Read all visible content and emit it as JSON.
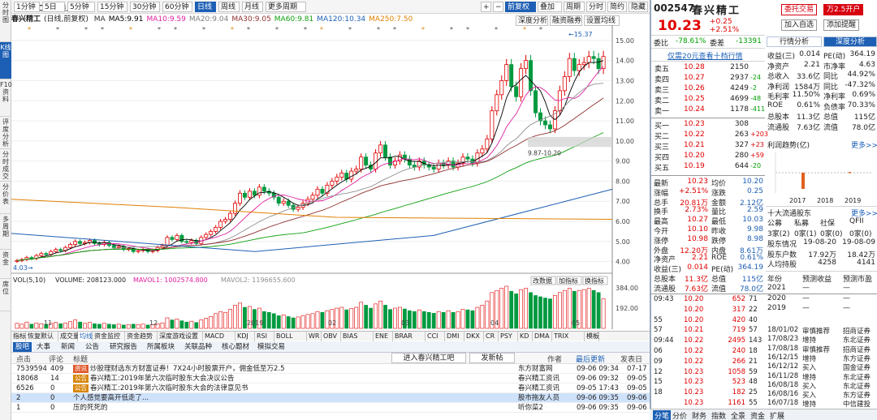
{
  "vertical_tabs": [
    "分时图",
    "K线图",
    "F10资料",
    "评度分析",
    "分时成交",
    "分价表",
    "多周期",
    "资金",
    "席位"
  ],
  "toolbar": {
    "stock_name": "春兴精工",
    "mode": "(日线,前复权)",
    "periods": [
      "1分钟",
      "5日",
      "5分钟",
      "15分钟",
      "30分钟",
      "60分钟",
      "日线",
      "周线",
      "月线",
      "更多周期"
    ],
    "selected_period": "日线",
    "right_buttons": [
      "+",
      "−",
      "前复权",
      "叠加",
      "周期",
      "分时",
      "简约",
      "隐藏",
      "均线"
    ],
    "sub_buttons": [
      "深度分析",
      "融资融券",
      "设置均线"
    ]
  },
  "ma_legend": [
    {
      "label": "MA",
      "value": "",
      "color": "#333333"
    },
    {
      "label": "MA5:",
      "value": "9.91",
      "color": "#000000"
    },
    {
      "label": "MA10:",
      "value": "9.59",
      "color": "#e020a0"
    },
    {
      "label": "MA20:",
      "value": "9.04",
      "color": "#808080"
    },
    {
      "label": "MA30:",
      "value": "9.05",
      "color": "#903030"
    },
    {
      "label": "MA60:",
      "value": "9.81",
      "color": "#10a010"
    },
    {
      "label": "MA120:",
      "value": "10.34",
      "color": "#1d5fb4"
    },
    {
      "label": "MA250:",
      "value": "7.50",
      "color": "#e08000"
    }
  ],
  "chart_data": {
    "type": "candlestick",
    "y_ticks": [
      "15.00",
      "14.00",
      "13.00",
      "12.00",
      "11.00",
      "10.00",
      "9.00",
      "8.00",
      "7.00",
      "6.00",
      "5.00",
      "4.00"
    ],
    "x_labels": [
      "11",
      "12",
      "2019",
      "02",
      "03",
      "04",
      "05"
    ],
    "high_label": "15.37",
    "low_label": "4.03",
    "mark_label": "9.87-10.20",
    "volume_ticks": [
      "384.00",
      "192.00"
    ],
    "volume_legend": {
      "vol": "VOL(5,10)",
      "volume": "VOLUME: 208123.000",
      "mavol1": "MAVOL1: 1002574.800",
      "mavol2": "MAVOL2: 1196655.600"
    },
    "volume_buttons": [
      "改数据",
      "加指标",
      "换指标"
    ],
    "price_ylim": [
      3.5,
      15.6
    ],
    "candles_close": [
      4.05,
      4.1,
      4.2,
      4.15,
      4.3,
      4.4,
      4.35,
      4.5,
      4.6,
      4.55,
      4.7,
      4.85,
      5.0,
      4.9,
      4.95,
      5.05,
      4.9,
      4.85,
      4.95,
      4.8,
      4.7,
      4.75,
      4.6,
      4.65,
      4.5,
      4.55,
      4.6,
      4.5,
      4.55,
      4.7,
      4.8,
      5.2,
      5.1,
      5.3,
      5.0,
      4.95,
      5.05,
      4.9,
      5.2,
      5.35,
      5.5,
      5.7,
      6.0,
      6.1,
      6.4,
      6.9,
      7.4,
      7.2,
      7.5,
      7.3,
      7.7,
      7.5,
      7.4,
      7.2,
      6.9,
      7.0,
      6.8,
      6.6,
      6.7,
      6.9,
      7.1,
      7.3,
      7.6,
      7.4,
      7.8,
      8.0,
      8.2,
      8.4,
      8.1,
      8.5,
      8.6,
      9.2,
      8.8,
      8.6,
      9.4,
      9.8,
      9.2,
      8.8,
      9.0,
      9.3,
      9.1,
      8.8,
      8.7,
      9.0,
      8.8,
      8.7,
      8.6,
      8.9,
      8.8,
      9.0,
      8.7,
      8.9,
      9.2,
      9.1,
      8.9,
      9.4,
      9.6,
      10.1,
      11.5,
      12.3,
      13.0,
      13.8,
      12.7,
      12.2,
      13.6,
      14.0,
      12.5,
      11.4,
      11.0,
      10.8,
      10.6,
      11.5,
      12.5,
      13.2,
      14.1,
      13.5,
      13.8,
      13.9,
      14.2,
      14.1,
      13.6,
      14.2
    ],
    "volume": [
      0.12,
      0.1,
      0.15,
      0.1,
      0.13,
      0.11,
      0.1,
      0.12,
      0.14,
      0.11,
      0.13,
      0.16,
      0.2,
      0.15,
      0.12,
      0.14,
      0.11,
      0.1,
      0.12,
      0.1,
      0.09,
      0.1,
      0.08,
      0.09,
      0.1,
      0.09,
      0.1,
      0.08,
      0.09,
      0.11,
      0.13,
      0.25,
      0.2,
      0.22,
      0.18,
      0.15,
      0.17,
      0.14,
      0.2,
      0.24,
      0.28,
      0.35,
      0.4,
      0.38,
      0.45,
      0.55,
      0.6,
      0.5,
      0.52,
      0.45,
      0.48,
      0.4,
      0.38,
      0.35,
      0.3,
      0.32,
      0.28,
      0.25,
      0.27,
      0.3,
      0.33,
      0.35,
      0.4,
      0.38,
      0.42,
      0.45,
      0.48,
      0.5,
      0.44,
      0.47,
      0.5,
      0.62,
      0.55,
      0.48,
      0.58,
      0.65,
      0.55,
      0.45,
      0.48,
      0.5,
      0.46,
      0.42,
      0.4,
      0.44,
      0.4,
      0.38,
      0.36,
      0.4,
      0.38,
      0.42,
      0.38,
      0.4,
      0.45,
      0.44,
      0.42,
      0.5,
      0.55,
      0.65,
      0.85,
      0.9,
      0.95,
      1.0,
      0.88,
      0.82,
      0.92,
      0.95,
      0.85,
      0.78,
      0.75,
      0.72,
      0.7,
      0.78,
      0.85,
      0.9,
      0.95,
      0.88,
      0.9,
      0.92,
      0.95,
      0.9,
      0.85,
      0.7
    ]
  },
  "indicator_tabs": [
    "指标",
    "恢复默认",
    "成交量",
    "均线",
    "资金监控",
    "资金趋势",
    "深度游戏设置",
    "MACD",
    "KDJ",
    "RSI",
    "BOLL",
    "WR",
    "OBV",
    "BIAS",
    "ENE",
    "BRAR",
    "CCI",
    "DMI",
    "DKX",
    "CR",
    "PSY",
    "KD",
    "DMA",
    "TRIX",
    "模板"
  ],
  "news": {
    "tabs": [
      "股吧",
      "大事",
      "新闻",
      "公告",
      "研究报告",
      "所属板块",
      "关联品种",
      "核心题材",
      "模拟交易"
    ],
    "bar_buttons": [
      "进入春兴精工吧",
      "发新帖"
    ],
    "headers": {
      "clicks": "点击",
      "comments": "评论",
      "title": "标题",
      "author": "作者",
      "updated": "最后更新",
      "posted": "发表日"
    },
    "rows": [
      {
        "clicks": "7539594",
        "comments": "409",
        "tag": "资讯",
        "title": "炒股理财选东方财富证券！7X24小时股票开户，佣金低至万2.5",
        "author": "东方财富网",
        "updated": "09-06 09:34",
        "posted": "07-17"
      },
      {
        "clicks": "18068",
        "comments": "14",
        "tag": "公告",
        "title": "春兴精工:2019年第六次临时股东大会决议公告",
        "author": "春兴精工资讯",
        "updated": "09-06 09:32",
        "posted": "09-05"
      },
      {
        "clicks": "6526",
        "comments": "0",
        "tag": "公告",
        "title": "春兴精工:2019年第六次临时股东大会的法律意见书",
        "author": "春兴精工资讯",
        "updated": "09-05 17:43",
        "posted": "09-05"
      },
      {
        "clicks": "2",
        "comments": "0",
        "tag": "",
        "title": "个人感觉要高开低走了...",
        "author": "股市拖友人员",
        "updated": "09-06 09:35",
        "posted": "09-06"
      },
      {
        "clicks": "1",
        "comments": "0",
        "tag": "",
        "title": "压的死死的",
        "author": "听你菜2",
        "updated": "09-06 09:35",
        "posted": "09-06"
      }
    ]
  },
  "quote": {
    "code": "002547",
    "name": "春兴精工",
    "buttons": [
      "委托交易",
      "万2.5开户",
      "加入自选",
      "添加提醒"
    ],
    "price": "10.23",
    "change": "+0.25",
    "change_pct": "+2.51%",
    "weibi_label": "委比",
    "weibi": "-78.61%",
    "weicha_label": "委差",
    "weicha": "-13391",
    "sub_tabs": [
      "行情分析",
      "深度分析"
    ],
    "level2_link": "仅需20元查看十档行情",
    "asks": [
      {
        "label": "卖五",
        "price": "10.28",
        "vol": "2150",
        "chg": ""
      },
      {
        "label": "卖四",
        "price": "10.27",
        "vol": "2937",
        "chg": "-24"
      },
      {
        "label": "卖三",
        "price": "10.26",
        "vol": "4249",
        "chg": "-2"
      },
      {
        "label": "卖二",
        "price": "10.25",
        "vol": "4699",
        "chg": "-48"
      },
      {
        "label": "卖一",
        "price": "10.24",
        "vol": "1178",
        "chg": "-411"
      }
    ],
    "bids": [
      {
        "label": "买一",
        "price": "10.23",
        "vol": "308",
        "chg": ""
      },
      {
        "label": "买二",
        "price": "10.22",
        "vol": "263",
        "chg": "+203"
      },
      {
        "label": "买三",
        "price": "10.21",
        "vol": "327",
        "chg": "+23"
      },
      {
        "label": "买四",
        "price": "10.20",
        "vol": "280",
        "chg": "+59"
      },
      {
        "label": "买五",
        "price": "10.19",
        "vol": "644",
        "chg": "-20"
      }
    ],
    "stats": [
      [
        "最新",
        "10.23",
        "均价",
        "10.20"
      ],
      [
        "涨幅",
        "+2.51%",
        "涨跌",
        "0.25"
      ],
      [
        "总手",
        "20.81万",
        "金额",
        "2.12亿"
      ],
      [
        "换手",
        "2.73%",
        "量比",
        "2.59"
      ],
      [
        "最高",
        "10.27",
        "最低",
        "10.03"
      ],
      [
        "今开",
        "10.10",
        "昨收",
        "9.98"
      ],
      [
        "涨停",
        "10.98",
        "跌停",
        "8.98"
      ],
      [
        "外盘",
        "12.20万",
        "内盘",
        "8.61万"
      ],
      [
        "净资产",
        "2.21",
        "ROE",
        "0.61%"
      ],
      [
        "收益(三)",
        "0.014",
        "PE(动)",
        "364.19"
      ],
      [
        "总股本",
        "11.3亿",
        "总值",
        "115亿"
      ],
      [
        "流通股",
        "7.63亿",
        "流值",
        "78.0亿"
      ]
    ],
    "fin": [
      [
        "收益(三)",
        "0.014",
        "PE(动)",
        "364.19"
      ],
      [
        "净资产",
        "2.21",
        "市净率",
        "4.63"
      ],
      [
        "总收入",
        "33.6亿",
        "同比",
        "44.92%"
      ],
      [
        "净利润",
        "1584万",
        "同比",
        "-47.32%"
      ],
      [
        "毛利率",
        "11.50%",
        "净利率",
        "0.69%"
      ],
      [
        "ROE",
        "0.61%",
        "负债率",
        "70.33%"
      ],
      [
        "总股本",
        "11.3亿",
        "总值",
        "115亿"
      ],
      [
        "流通股",
        "7.63亿",
        "流值",
        "78.0亿"
      ]
    ],
    "profit_title": "利润趋势(亿)",
    "profit_more": "更多>>",
    "profit_years": [
      "2017",
      "2018",
      "2019"
    ],
    "holders_title": "十大流通股东",
    "holders_more": "更多>>",
    "holders_head": [
      "公募",
      "私募",
      "社保",
      "QFII"
    ],
    "holders_row": [
      "3家(2)",
      "0家(1)",
      "0家(0)",
      "0家(0)"
    ],
    "holders_stats": [
      [
        "股东情况",
        "19-08-20",
        "19-08-09"
      ],
      [
        "股东户数",
        "17.92万",
        "18.42万"
      ],
      [
        "人均持股",
        "4258",
        "4141"
      ]
    ],
    "rating_head": [
      "年份",
      "预测收益",
      "预测市盈"
    ],
    "rating_rows": [
      [
        "2021",
        "—",
        "—"
      ],
      [
        "2020",
        "—",
        "—"
      ],
      [
        "2019",
        "—",
        "—"
      ]
    ],
    "ticks": [
      [
        "09:43",
        "10.20",
        "652",
        "71"
      ],
      [
        "",
        "10.20",
        "317",
        "22"
      ],
      [
        "55",
        "10.20",
        "420",
        "40"
      ],
      [
        "57",
        "10.21",
        "719",
        "57"
      ],
      [
        "09:44",
        "10.22",
        "2495",
        "143"
      ],
      [
        "06",
        "10.22",
        "240",
        "18"
      ],
      [
        "09",
        "10.22",
        "266",
        "21"
      ],
      [
        "12",
        "10.23",
        "1058",
        "59"
      ],
      [
        "15",
        "10.23",
        "523",
        "48"
      ],
      [
        "18",
        "10.23",
        "182",
        "25"
      ],
      [
        "",
        "10.23",
        "1161",
        "55"
      ]
    ],
    "reports": [
      [
        "18/01/02",
        "审慎推荐",
        "招商证券"
      ],
      [
        "17/08/23",
        "增持",
        "东北证券"
      ],
      [
        "17/08/18",
        "审慎推荐",
        "招商证券"
      ],
      [
        "16/12/15",
        "增持",
        "东方证券"
      ],
      [
        "16/12/12",
        "买入",
        "国金证券"
      ],
      [
        "16/11/28",
        "增持",
        "东北证券"
      ],
      [
        "16/08/18",
        "买入",
        "东北证券"
      ],
      [
        "16/08/16",
        "买入",
        "东方证券"
      ],
      [
        "16/07/18",
        "增持",
        "中信建投"
      ]
    ],
    "bottom_tabs": [
      "分笔",
      "分价",
      "财务",
      "指数",
      "全景",
      "资金",
      "扩展"
    ]
  }
}
